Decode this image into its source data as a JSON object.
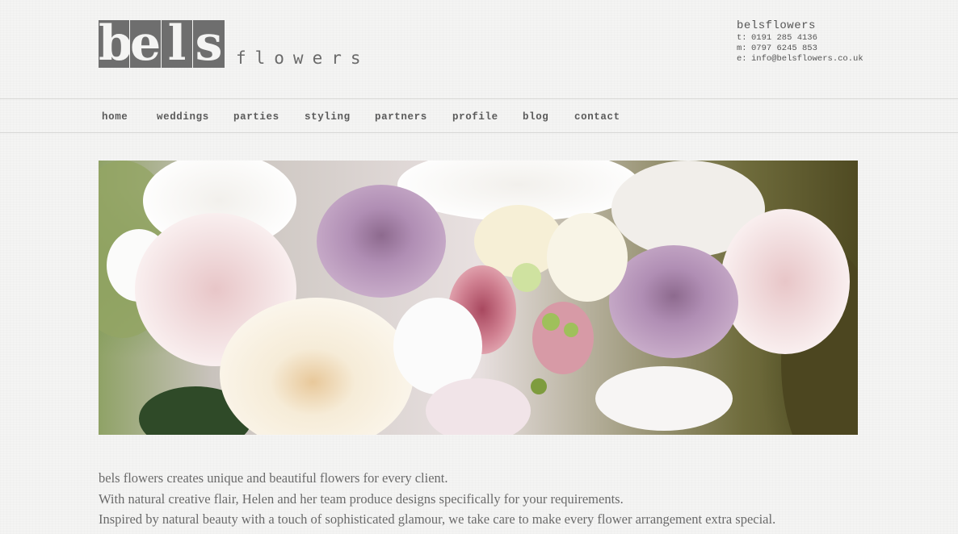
{
  "logo": {
    "letters": [
      "b",
      "e",
      "l",
      "s"
    ],
    "wordmark": "flowers"
  },
  "contact": {
    "name": "belsflowers",
    "rows": [
      {
        "label": "t:",
        "value": "0191 285 4136"
      },
      {
        "label": "m:",
        "value": "0797 6245 853"
      },
      {
        "label": "e:",
        "value": "info@belsflowers.co.uk"
      }
    ]
  },
  "nav": {
    "items": [
      "home",
      "weddings",
      "parties",
      "styling",
      "partners",
      "profile",
      "blog",
      "contact"
    ]
  },
  "hero": {
    "image_subject": "bouquet of pink, lilac and cream roses with white flowers"
  },
  "intro": {
    "lines": [
      "bels flowers creates unique and beautiful flowers for every client.",
      "With natural creative flair, Helen and her team produce designs specifically for your requirements.",
      "Inspired by natural beauty with a touch of sophisticated glamour, we take care to make every flower arrangement extra special."
    ]
  },
  "colors": {
    "background": "#f4f4f3",
    "logo_box": "#6e6e6e",
    "text": "#6a6a6a",
    "rule": "#d8d8d6"
  }
}
